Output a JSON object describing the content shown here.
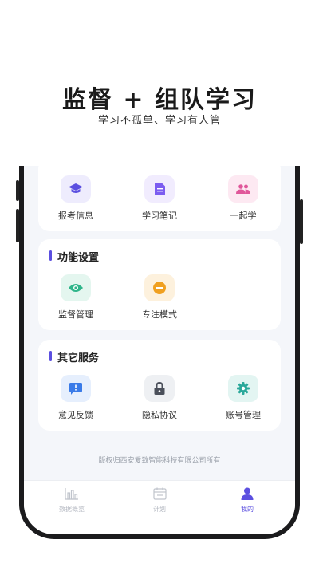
{
  "promo": {
    "title": "监督 + 组队学习",
    "subtitle": "学习不孤单、学习有人管"
  },
  "top_card": {
    "items": [
      {
        "label": "报考信息",
        "icon": "graduation-cap-icon",
        "color": "#5b4fe0",
        "bg": "#eeecfd"
      },
      {
        "label": "学习笔记",
        "icon": "document-icon",
        "color": "#7b5cf0",
        "bg": "#f1ecfe"
      },
      {
        "label": "一起学",
        "icon": "people-icon",
        "color": "#e0579a",
        "bg": "#fde9f2"
      }
    ]
  },
  "function_settings": {
    "title": "功能设置",
    "items": [
      {
        "label": "监督管理",
        "icon": "eye-icon",
        "color": "#2fb58a",
        "bg": "#e4f6ef"
      },
      {
        "label": "专注模式",
        "icon": "minus-circle-icon",
        "color": "#f0a020",
        "bg": "#fdf1dd"
      }
    ]
  },
  "other_services": {
    "title": "其它服务",
    "items": [
      {
        "label": "意见反馈",
        "icon": "feedback-icon",
        "color": "#3a7be8",
        "bg": "#e6effd"
      },
      {
        "label": "隐私协议",
        "icon": "lock-icon",
        "color": "#4a4f5a",
        "bg": "#eef0f3"
      },
      {
        "label": "账号管理",
        "icon": "gear-icon",
        "color": "#2aa89a",
        "bg": "#e3f5f2"
      }
    ]
  },
  "footer": "版权归西安爱致智能科技有限公司所有",
  "tabbar": {
    "tabs": [
      {
        "label": "数据概览",
        "icon": "bar-chart-icon",
        "active": false
      },
      {
        "label": "计划",
        "icon": "calendar-icon",
        "active": false
      },
      {
        "label": "我的",
        "icon": "person-icon",
        "active": true
      }
    ]
  },
  "accent_color": "#5b4fe0"
}
